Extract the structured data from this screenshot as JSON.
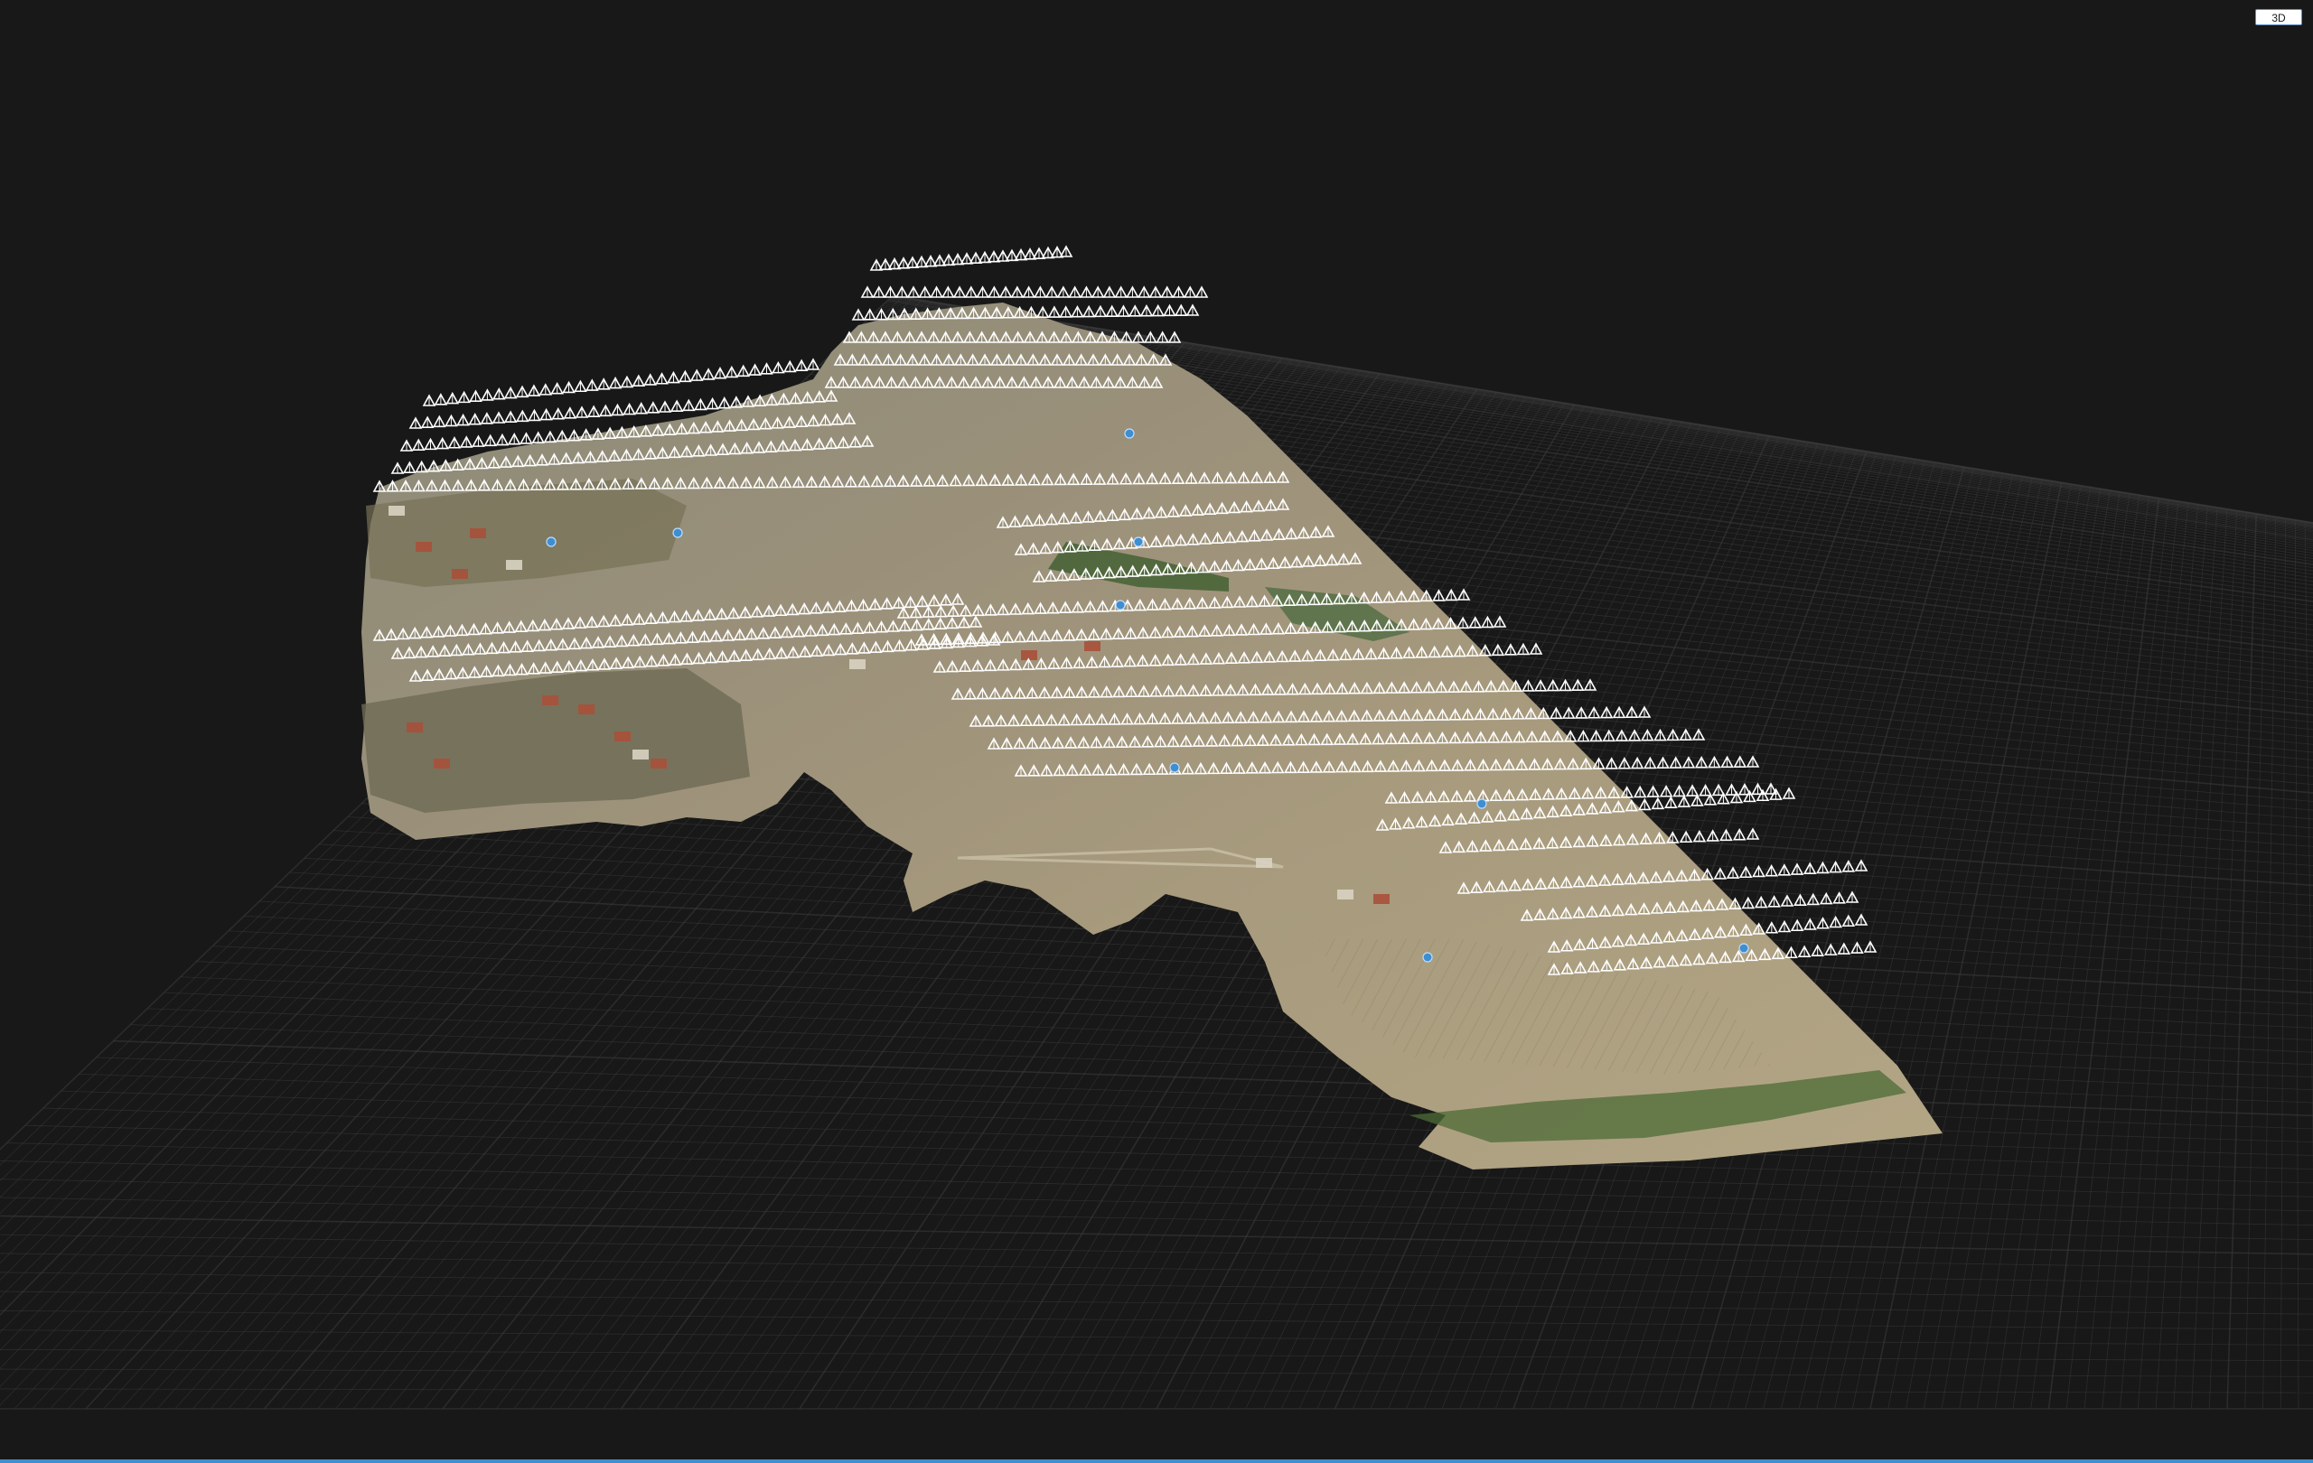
{
  "viewer": {
    "view_mode_label": "3D",
    "colors": {
      "background": "#181818",
      "grid": "#3c3c3c",
      "accent": "#3e8ed0",
      "camera_marker": "#ffffff"
    },
    "scene": {
      "ground_grid": true,
      "orthomosaic_terrain": true,
      "camera_marker_icon": "camera-pyramid-icon",
      "gcp_marker_icon": "gcp-marker-icon"
    }
  }
}
